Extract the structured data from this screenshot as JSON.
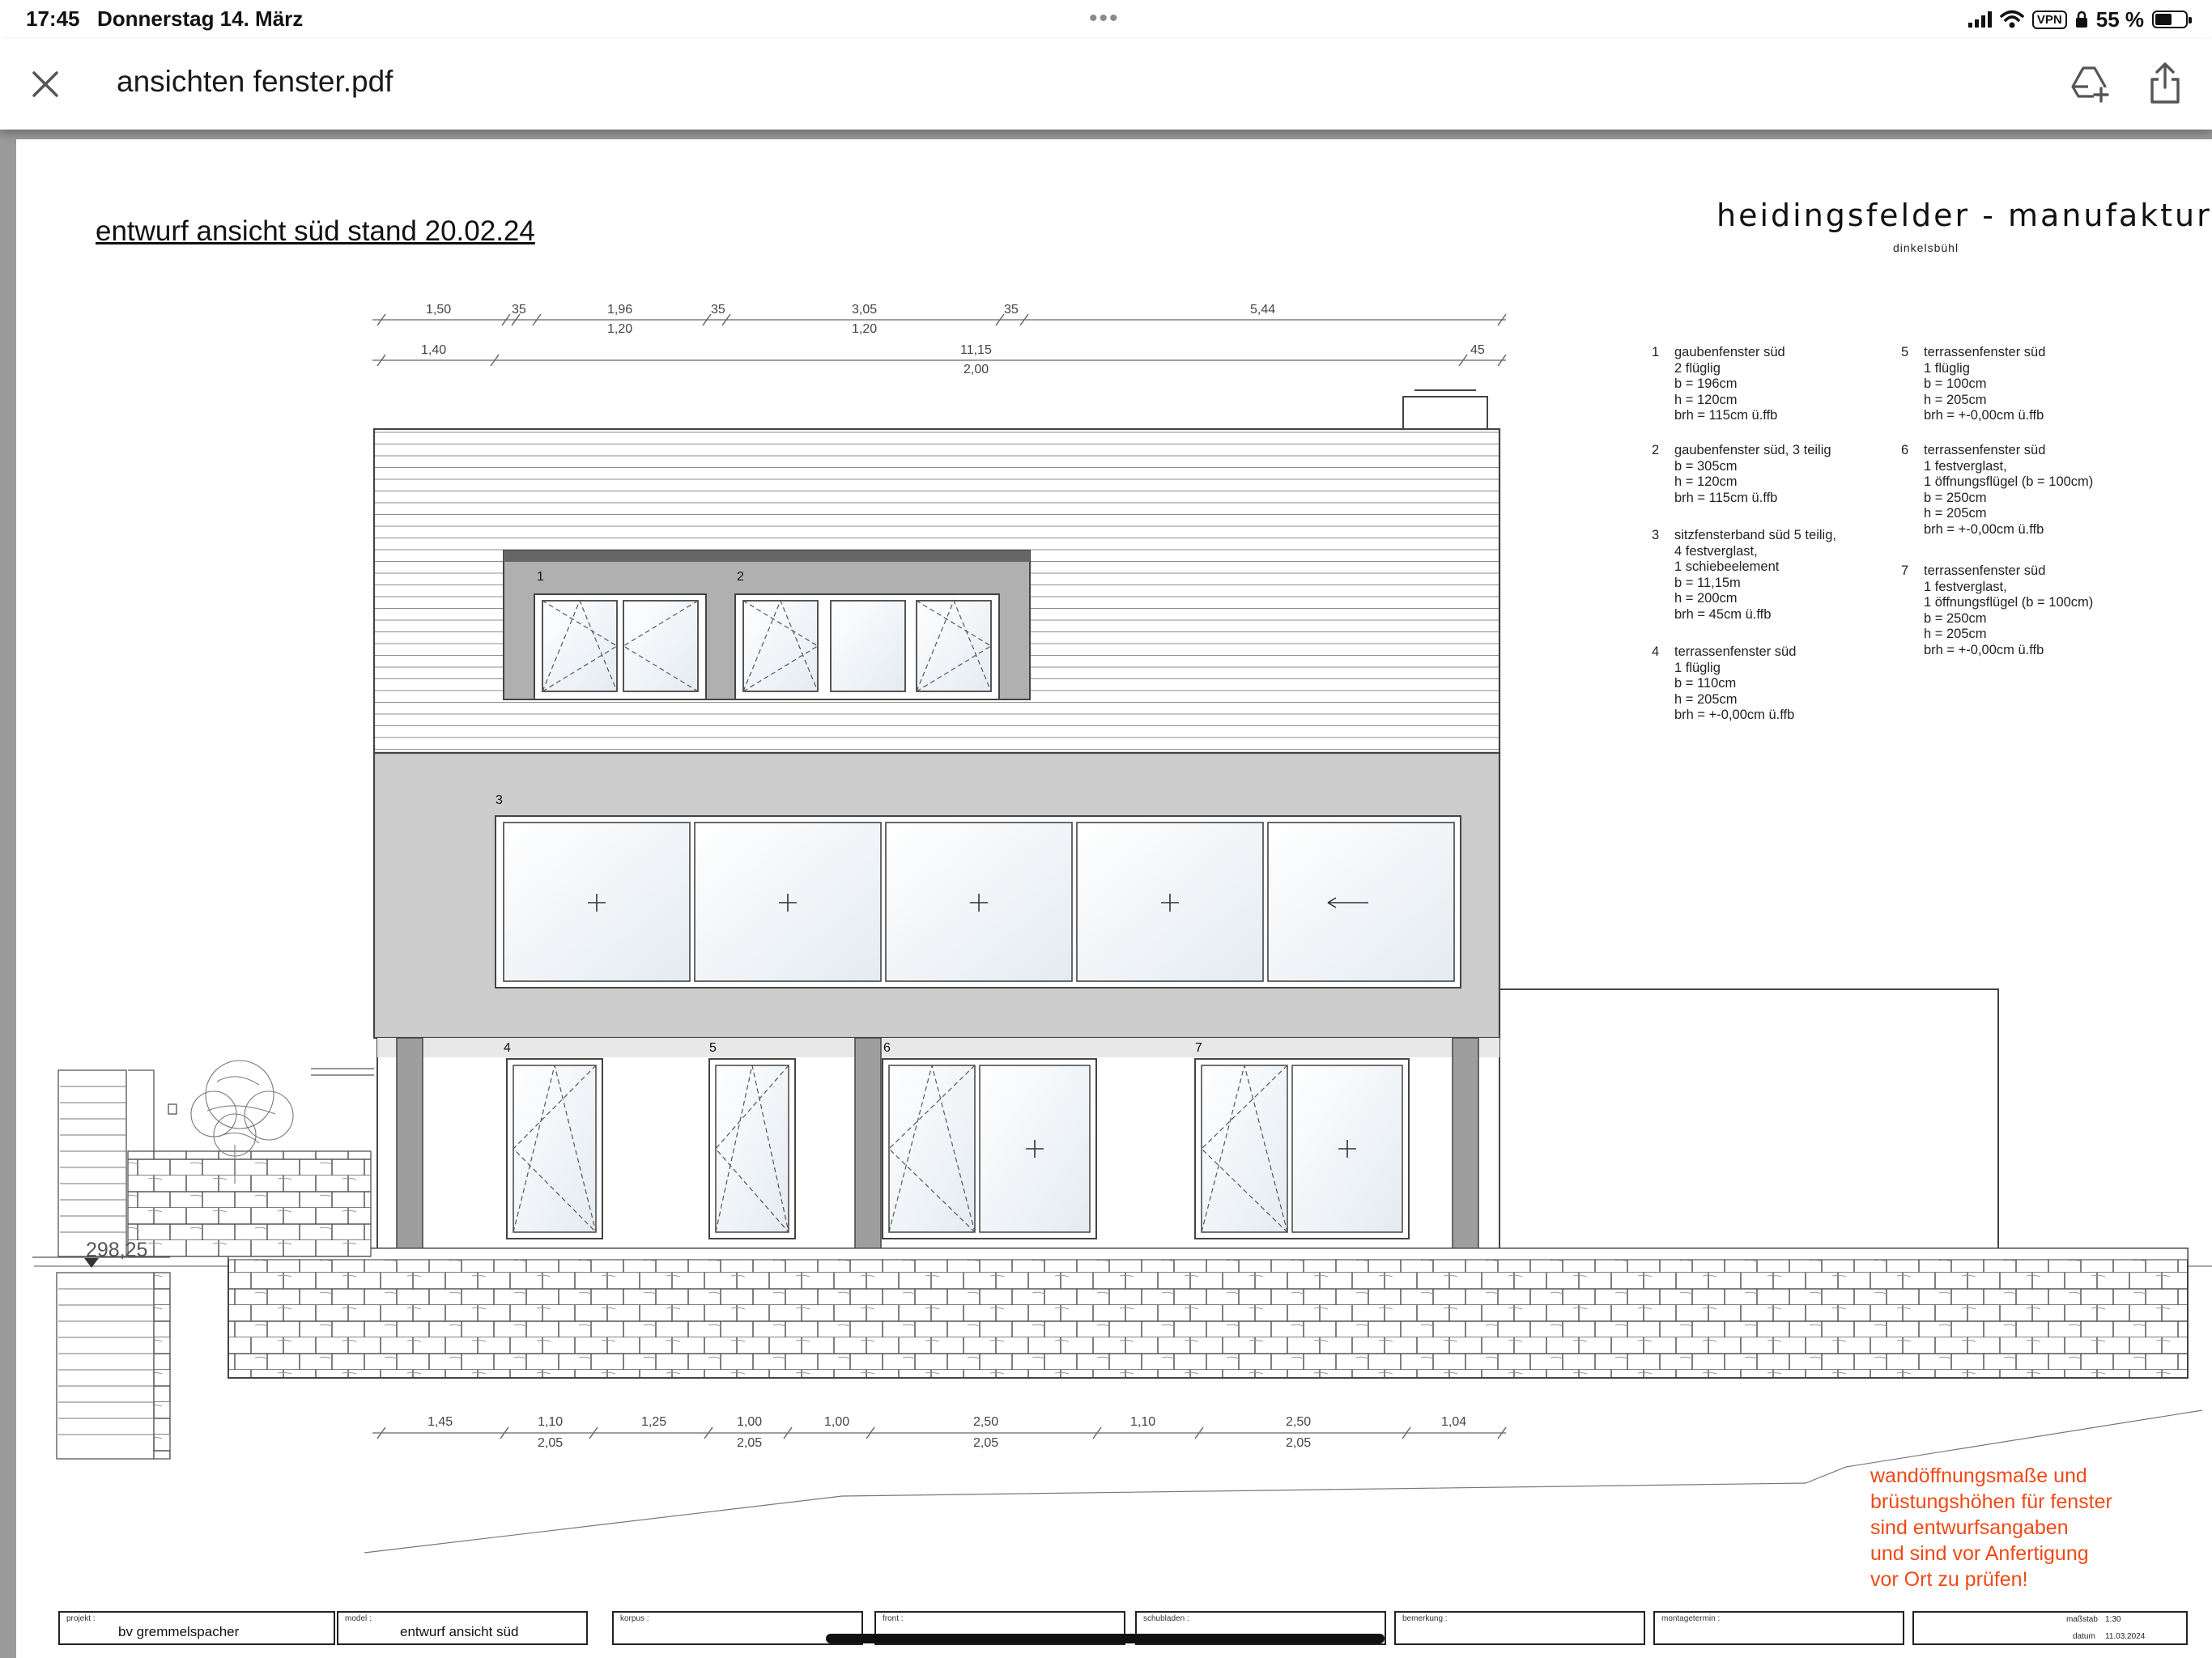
{
  "status_bar": {
    "time": "17:45",
    "date": "Donnerstag 14. März",
    "vpn": "VPN",
    "battery": "55 %",
    "battery_level": 0.55
  },
  "toolbar": {
    "title": "ansichten fenster.pdf",
    "icons": [
      "close-icon",
      "add-to-drive-icon",
      "share-icon"
    ]
  },
  "drawing": {
    "title": "entwurf ansicht süd stand 20.02.24",
    "brand": "heidingsfelder - manufaktur",
    "brand_sub": "dinkelsbühl",
    "level_mark": "298,25",
    "window_numbers": [
      "1",
      "2",
      "3",
      "4",
      "5",
      "6",
      "7"
    ],
    "dims_top_row1": [
      "1,50",
      "35",
      "1,96",
      "35",
      "3,05",
      "35",
      "5,44"
    ],
    "dims_top_row1_sub": [
      "1,20",
      "1,20"
    ],
    "dims_top_row2": [
      "1,40",
      "11,15",
      "45"
    ],
    "dims_top_row2_sub": [
      "2,00"
    ],
    "dims_bottom": [
      "1,45",
      "1,10",
      "1,25",
      "1,00",
      "1,00",
      "2,50",
      "1,10",
      "2,50",
      "1,04"
    ],
    "dims_bottom_sub": [
      "2,05",
      "2,05",
      "2,05",
      "2,05"
    ],
    "legend": [
      {
        "num": "1",
        "lines": [
          "gaubenfenster süd",
          "2 flüglig",
          "b = 196cm",
          "h = 120cm",
          "brh = 115cm ü.ffb"
        ]
      },
      {
        "num": "2",
        "lines": [
          "gaubenfenster süd, 3 teilig",
          "b = 305cm",
          "h = 120cm",
          "brh = 115cm ü.ffb"
        ]
      },
      {
        "num": "3",
        "lines": [
          "sitzfensterband süd 5 teilig,",
          "4 festverglast,",
          "1 schiebeelement",
          "b = 11,15m",
          "h = 200cm",
          "brh = 45cm ü.ffb"
        ]
      },
      {
        "num": "4",
        "lines": [
          "terrassenfenster süd",
          "1 flüglig",
          "b = 110cm",
          "h = 205cm",
          "brh = +-0,00cm ü.ffb"
        ]
      },
      {
        "num": "5",
        "lines": [
          "terrassenfenster süd",
          "1 flüglig",
          "b = 100cm",
          "h = 205cm",
          "brh = +-0,00cm ü.ffb"
        ]
      },
      {
        "num": "6",
        "lines": [
          "terrassenfenster süd",
          "1 festverglast,",
          "1 öffnungsflügel (b = 100cm)",
          "b = 250cm",
          "h = 205cm",
          "brh = +-0,00cm ü.ffb"
        ]
      },
      {
        "num": "7",
        "lines": [
          "terrassenfenster süd",
          "1 festverglast,",
          "1 öffnungsflügel (b = 100cm)",
          "b = 250cm",
          "h = 205cm",
          "brh = +-0,00cm ü.ffb"
        ]
      }
    ],
    "note": [
      "wandöffnungsmaße und",
      "brüstungshöhen für fenster",
      "sind entwurfsangaben",
      "und sind vor Anfertigung",
      "vor Ort zu prüfen!"
    ],
    "title_block": {
      "projekt_label": "projekt :",
      "projekt": "bv gremmelspacher",
      "model_label": "model :",
      "model": "entwurf ansicht süd",
      "korpus_label": "korpus :",
      "front_label": "front :",
      "schubladen_label": "schubladen :",
      "bemerkung_label": "bemerkung :",
      "montagetermin_label": "montagetermin :",
      "massstab_label": "maßstab",
      "massstab": "1:30",
      "datum_label": "datum",
      "datum": "11.03.2024"
    }
  }
}
